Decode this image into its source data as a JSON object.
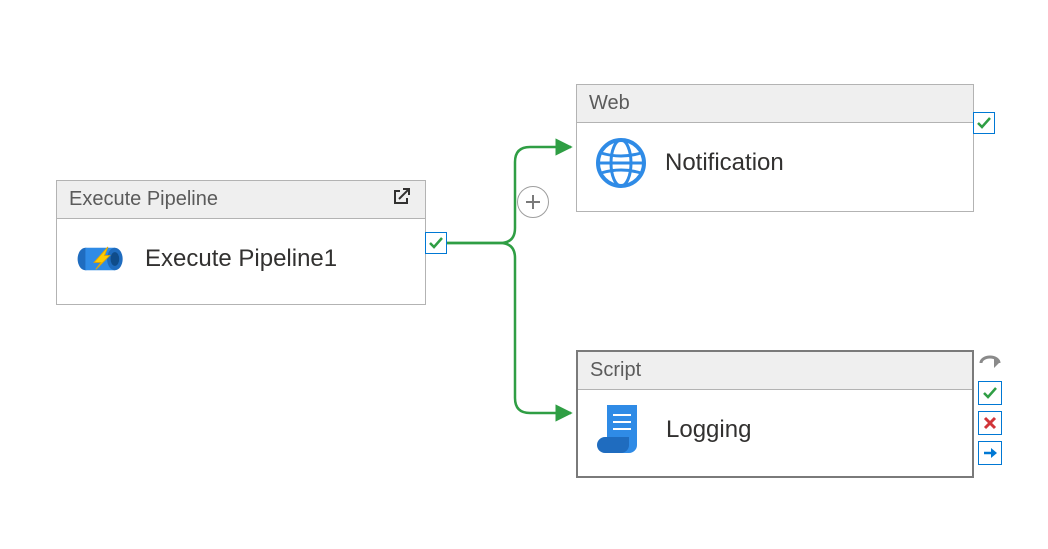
{
  "colors": {
    "success": "#2f9e44",
    "error": "#d83b01",
    "azure_blue": "#0078d4",
    "node_border": "#b3b3b3",
    "header_bg": "#efefef",
    "arrow_gray": "#8a8a8a"
  },
  "nodes": {
    "exec": {
      "type_label": "Execute Pipeline",
      "name": "Execute Pipeline1"
    },
    "web": {
      "type_label": "Web",
      "name": "Notification"
    },
    "script": {
      "type_label": "Script",
      "name": "Logging"
    }
  }
}
